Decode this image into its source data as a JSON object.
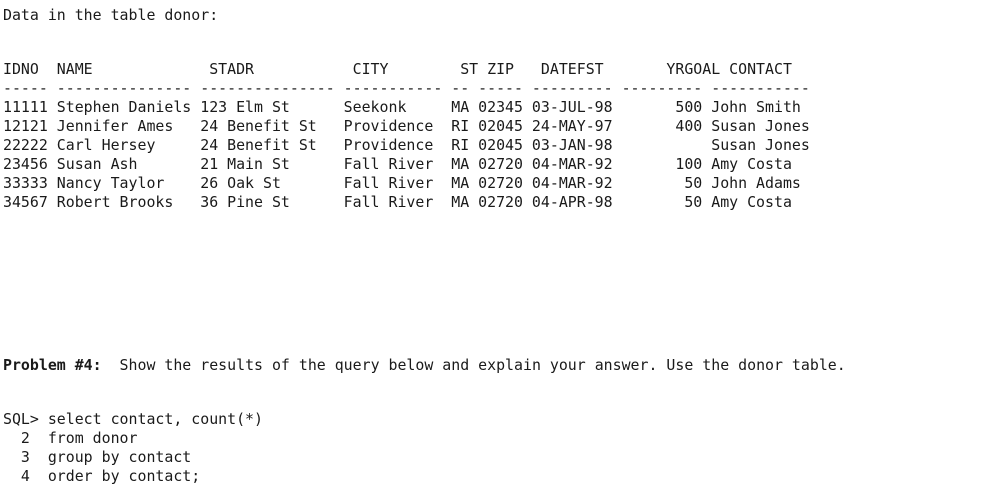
{
  "intro": "Data in the table donor:",
  "table": {
    "header": "IDNO  NAME             STADR           CITY        ST ZIP   DATEFST       YRGOAL CONTACT",
    "separator": "----- --------------- --------------- ----------- -- ----- --------- --------- -----------",
    "columns": [
      "IDNO",
      "NAME",
      "STADR",
      "CITY",
      "ST",
      "ZIP",
      "DATEFST",
      "YRGOAL",
      "CONTACT"
    ],
    "rows": [
      {
        "text": "11111 Stephen Daniels 123 Elm St      Seekonk     MA 02345 03-JUL-98       500 John Smith",
        "IDNO": "11111",
        "NAME": "Stephen Daniels",
        "STADR": "123 Elm St",
        "CITY": "Seekonk",
        "ST": "MA",
        "ZIP": "02345",
        "DATEFST": "03-JUL-98",
        "YRGOAL": "500",
        "CONTACT": "John Smith"
      },
      {
        "text": "12121 Jennifer Ames   24 Benefit St   Providence  RI 02045 24-MAY-97       400 Susan Jones",
        "IDNO": "12121",
        "NAME": "Jennifer Ames",
        "STADR": "24 Benefit St",
        "CITY": "Providence",
        "ST": "RI",
        "ZIP": "02045",
        "DATEFST": "24-MAY-97",
        "YRGOAL": "400",
        "CONTACT": "Susan Jones"
      },
      {
        "text": "22222 Carl Hersey     24 Benefit St   Providence  RI 02045 03-JAN-98           Susan Jones",
        "IDNO": "22222",
        "NAME": "Carl Hersey",
        "STADR": "24 Benefit St",
        "CITY": "Providence",
        "ST": "RI",
        "ZIP": "02045",
        "DATEFST": "03-JAN-98",
        "YRGOAL": "",
        "CONTACT": "Susan Jones"
      },
      {
        "text": "23456 Susan Ash       21 Main St      Fall River  MA 02720 04-MAR-92       100 Amy Costa",
        "IDNO": "23456",
        "NAME": "Susan Ash",
        "STADR": "21 Main St",
        "CITY": "Fall River",
        "ST": "MA",
        "ZIP": "02720",
        "DATEFST": "04-MAR-92",
        "YRGOAL": "100",
        "CONTACT": "Amy Costa"
      },
      {
        "text": "33333 Nancy Taylor    26 Oak St       Fall River  MA 02720 04-MAR-92        50 John Adams",
        "IDNO": "33333",
        "NAME": "Nancy Taylor",
        "STADR": "26 Oak St",
        "CITY": "Fall River",
        "ST": "MA",
        "ZIP": "02720",
        "DATEFST": "04-MAR-92",
        "YRGOAL": "50",
        "CONTACT": "John Adams"
      },
      {
        "text": "34567 Robert Brooks   36 Pine St      Fall River  MA 02720 04-APR-98        50 Amy Costa",
        "IDNO": "34567",
        "NAME": "Robert Brooks",
        "STADR": "36 Pine St",
        "CITY": "Fall River",
        "ST": "MA",
        "ZIP": "02720",
        "DATEFST": "04-APR-98",
        "YRGOAL": "50",
        "CONTACT": "Amy Costa"
      }
    ]
  },
  "problem": {
    "label": "Problem #4:",
    "text": "  Show the results of the query below and explain your answer. Use the donor table."
  },
  "sql": {
    "lines": [
      "SQL> select contact, count(*)",
      "  2  from donor",
      "  3  group by contact",
      "  4  order by contact;"
    ]
  }
}
